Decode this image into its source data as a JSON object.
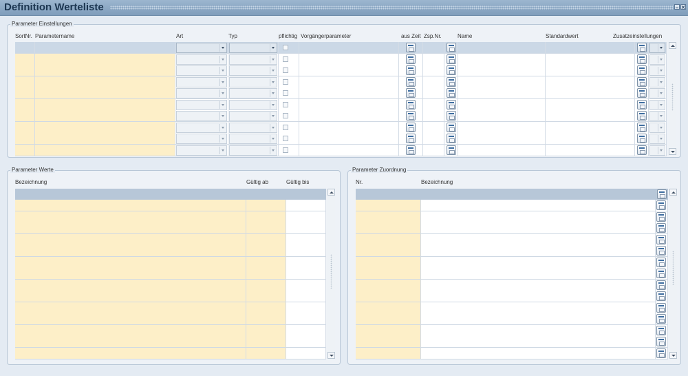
{
  "window": {
    "title": "Definition Werteliste"
  },
  "einstellungen": {
    "legend": "Parameter Einstellungen",
    "columns": {
      "sortnr": "SortNr.",
      "parametername": "Parametername",
      "art": "Art",
      "typ": "Typ",
      "pflichtig": "pflichtig",
      "vorgaenger": "Vorgängerparameter",
      "auszeit": "aus Zeit",
      "zspnr": "Zsp.Nr.",
      "name": "Name",
      "standardwert": "Standardwert",
      "zusatz": "Zusatzeinstellungen"
    },
    "row_count": 10,
    "selected_row": 0
  },
  "werte": {
    "legend": "Parameter Werte",
    "columns": {
      "bezeichnung": "Bezeichnung",
      "gueltig_ab": "Gültig ab",
      "gueltig_bis": "Gültig bis"
    },
    "row_count": 14
  },
  "zuordnung": {
    "legend": "Parameter Zuordnung",
    "columns": {
      "nr": "Nr.",
      "bezeichnung": "Bezeichnung"
    },
    "row_count": 14
  }
}
